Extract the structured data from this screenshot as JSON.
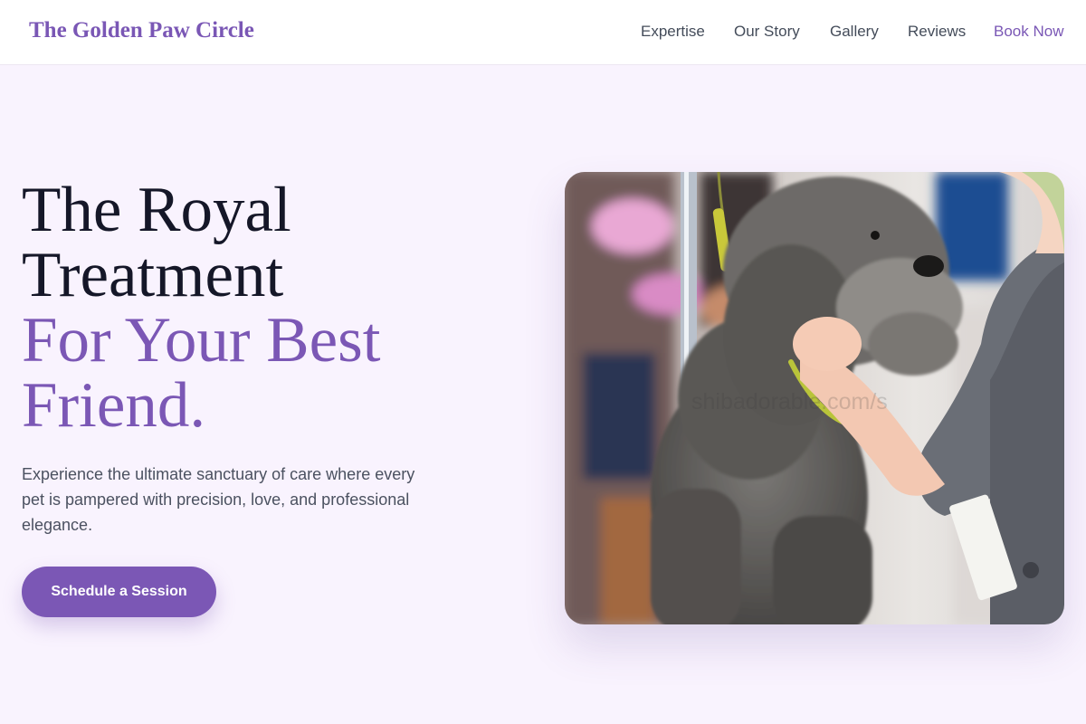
{
  "header": {
    "brand": "The Golden Paw Circle",
    "nav": [
      "Expertise",
      "Our Story",
      "Gallery",
      "Reviews",
      "Book Now"
    ],
    "accent_color": "#7a57b5"
  },
  "hero": {
    "title_dark": [
      "The Royal",
      "Treatment"
    ],
    "title_accent": [
      "For Your Best",
      "Friend."
    ],
    "subtitle": "Experience the ultimate sanctuary of care where every pet is pampered with precision, love, and professional elegance.",
    "cta_label": "Schedule a Session",
    "photo_watermark": "shibadorable.com/s"
  },
  "colors": {
    "background": "#f9f3fe",
    "header_bg": "#ffffff",
    "title_dark": "#151728",
    "title_accent": "#7b57b5",
    "body_text": "#4b5160",
    "button_bg": "#7b57b5",
    "button_text": "#ffffff"
  }
}
